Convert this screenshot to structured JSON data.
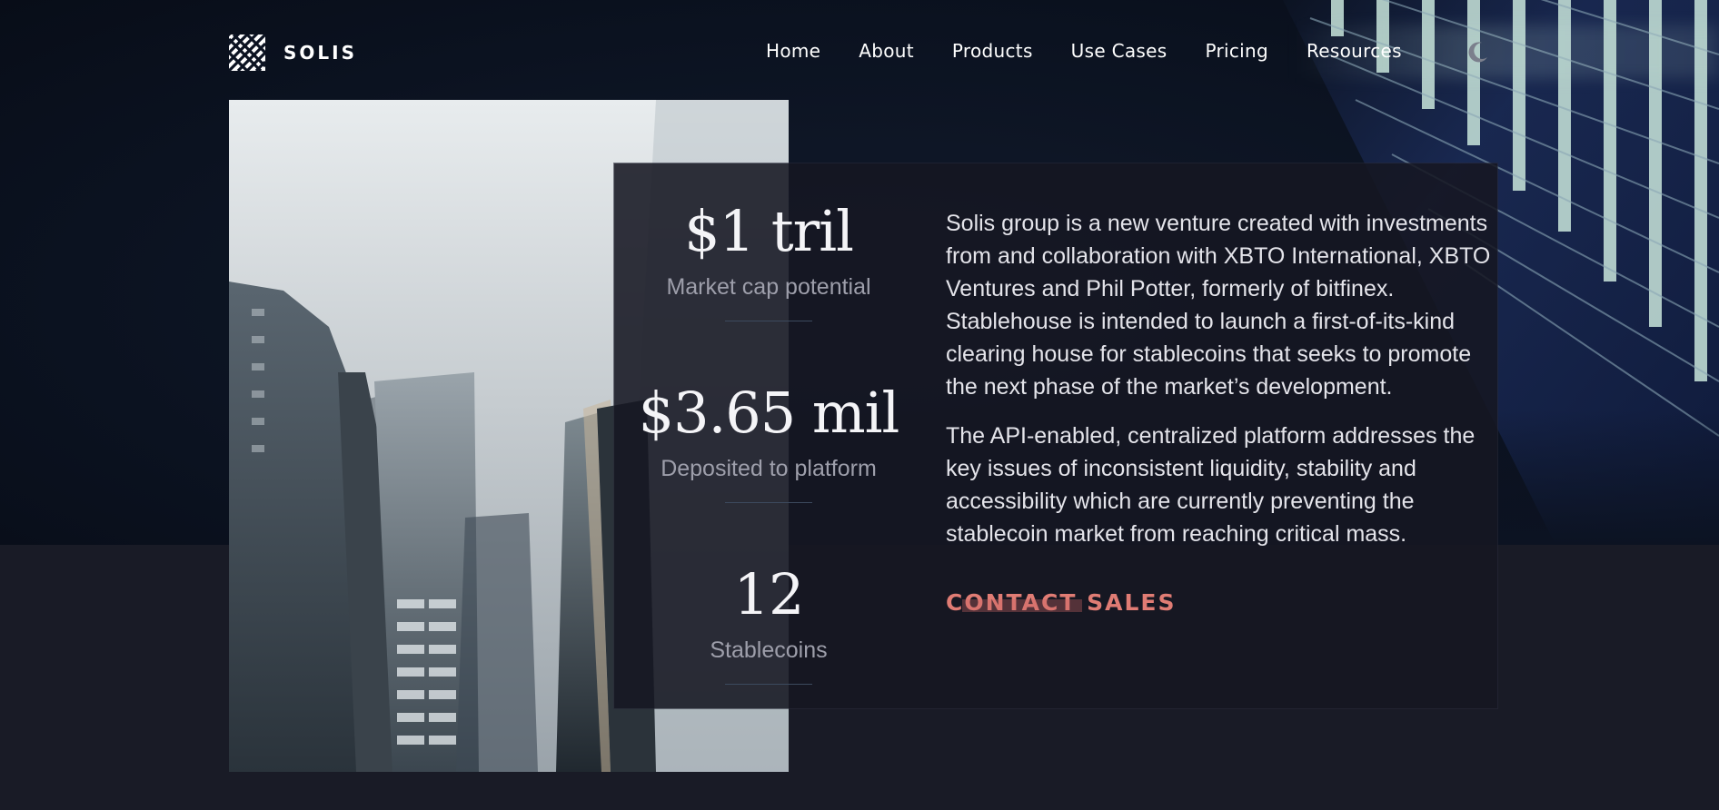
{
  "brand": {
    "name": "SOLIS"
  },
  "nav": {
    "items": [
      "Home",
      "About",
      "Products",
      "Use Cases",
      "Pricing",
      "Resources"
    ],
    "theme_toggle_icon": "moon-icon"
  },
  "stats": [
    {
      "value": "$1 tril",
      "label": "Market cap potential"
    },
    {
      "value": "$3.65 mil",
      "label": "Deposited to platform"
    },
    {
      "value": "12",
      "label": "Stablecoins"
    }
  ],
  "copy": {
    "paragraph_1": "Solis group is a new venture created with investments from and collaboration with XBTO International, XBTO Ventures and Phil Potter, formerly of bitfinex. Stablehouse is intended to launch a first-of-its-kind clearing house for stablecoins that seeks to promote the next phase of the market’s development.",
    "paragraph_2": "The API-enabled, centralized platform addresses the key issues of inconsistent liquidity, stability and accessibility which are currently preventing the stablecoin market from reaching critical mass."
  },
  "cta": {
    "label": "CONTACT SALES"
  },
  "colors": {
    "hero_background": "#0c1322",
    "page_background": "#191b26",
    "card_background": "#161722",
    "accent": "#e07c74",
    "text": "#e4e4ea",
    "muted": "#9e9fab"
  }
}
